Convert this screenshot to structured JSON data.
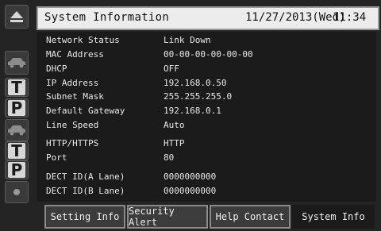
{
  "header": {
    "title": "System Information",
    "date": "11/27/2013(Wed)",
    "time": "11:34"
  },
  "info": [
    {
      "label": "Network Status",
      "value": "Link Down"
    },
    {
      "label": "MAC Address",
      "value": "00-00-00-00-00-00"
    },
    {
      "label": "DHCP",
      "value": "OFF"
    },
    {
      "label": "IP Address",
      "value": "192.168.0.50"
    },
    {
      "label": "Subnet Mask",
      "value": "255.255.255.0"
    },
    {
      "label": "Default Gateway",
      "value": "192.168.0.1"
    },
    {
      "label": "Line Speed",
      "value": "Auto"
    },
    {
      "label": "HTTP/HTTPS",
      "value": "HTTP"
    },
    {
      "label": "Port",
      "value": "80"
    },
    {
      "label": "DECT ID(A Lane)",
      "value": "0000000000"
    },
    {
      "label": "DECT ID(B Lane)",
      "value": "0000000000"
    }
  ],
  "rail": {
    "icons": [
      "eject-icon",
      "car-icon",
      "letter-t",
      "letter-p",
      "car-icon",
      "letter-t",
      "letter-p",
      "dot-icon"
    ],
    "letters": {
      "t": "T",
      "p": "P"
    }
  },
  "tabs": [
    {
      "label": "Setting Info",
      "active": false
    },
    {
      "label": "Security Alert",
      "active": false
    },
    {
      "label": "Help Contact",
      "active": false
    },
    {
      "label": "System Info",
      "active": true
    }
  ]
}
